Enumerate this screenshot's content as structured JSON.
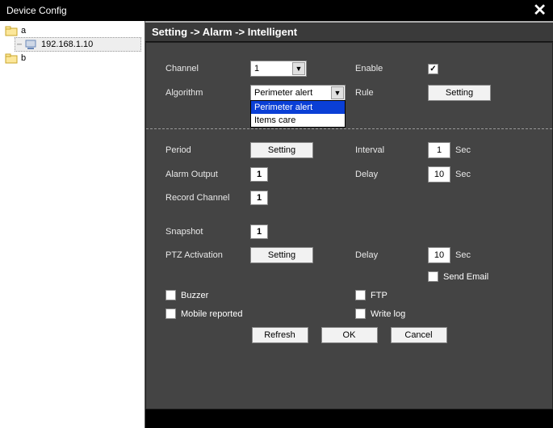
{
  "title": "Device Config",
  "tree": {
    "a": "a",
    "ip": "192.168.1.10",
    "b": "b"
  },
  "breadcrumb": "Setting -> Alarm -> Intelligent",
  "labels": {
    "channel": "Channel",
    "enable": "Enable",
    "algorithm": "Algorithm",
    "rule": "Rule",
    "period": "Period",
    "interval": "Interval",
    "alarmOutput": "Alarm Output",
    "delay": "Delay",
    "recordChannel": "Record Channel",
    "snapshot": "Snapshot",
    "ptz": "PTZ Activation",
    "sendEmail": "Send Email",
    "buzzer": "Buzzer",
    "ftp": "FTP",
    "mobile": "Mobile reported",
    "writelog": "Write log",
    "sec": "Sec"
  },
  "values": {
    "channel": "1",
    "enableChecked": true,
    "algorithm": "Perimeter alert",
    "algorithmOptions": [
      "Perimeter alert",
      "Items care"
    ],
    "interval": "1",
    "delay1": "10",
    "alarmOutput": "1",
    "recordChannel": "1",
    "snapshot": "1",
    "delay2": "10",
    "sendEmail": false,
    "buzzer": false,
    "ftp": false,
    "mobile": false,
    "writelog": false
  },
  "buttons": {
    "setting": "Setting",
    "refresh": "Refresh",
    "ok": "OK",
    "cancel": "Cancel"
  }
}
